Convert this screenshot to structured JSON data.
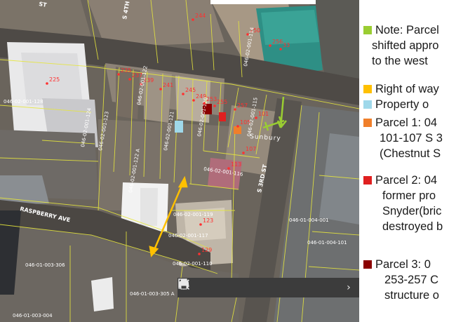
{
  "colors": {
    "note": "#9acd32",
    "row": "#ffc000",
    "property": "#9fd8ea",
    "parcel1": "#f07f2a",
    "parcel2": "#e02020",
    "parcel3": "#8b0000",
    "parcel_line": "#e6e63c",
    "address": "#ff3030"
  },
  "map": {
    "roads": {
      "raspberry": "RASPBERRY AVE",
      "third": "S 3RD ST",
      "fourth": "S 4TH",
      "top": "ST"
    },
    "town_label": "Sunbury",
    "addresses": [
      {
        "id": "a244",
        "text": "244"
      },
      {
        "id": "a250",
        "text": "250"
      },
      {
        "id": "a256",
        "text": "256"
      },
      {
        "id": "a33",
        "text": "33"
      },
      {
        "id": "a225",
        "text": "225"
      },
      {
        "id": "a235",
        "text": "235"
      },
      {
        "id": "a237",
        "text": "237"
      },
      {
        "id": "a239",
        "text": "239"
      },
      {
        "id": "a241",
        "text": "241"
      },
      {
        "id": "a245",
        "text": "245"
      },
      {
        "id": "a249",
        "text": "249"
      },
      {
        "id": "a253",
        "text": "253"
      },
      {
        "id": "a255",
        "text": "255"
      },
      {
        "id": "a257",
        "text": "257"
      },
      {
        "id": "a101",
        "text": "101"
      },
      {
        "id": "a105",
        "text": "105"
      },
      {
        "id": "a107",
        "text": "107"
      },
      {
        "id": "a113",
        "text": "113"
      },
      {
        "id": "a123",
        "text": "123"
      },
      {
        "id": "a129",
        "text": "129"
      }
    ],
    "parcel_ids": [
      {
        "id": "p1",
        "text": "046-02-001-128"
      },
      {
        "id": "p2",
        "text": "046-02-001-124"
      },
      {
        "id": "p3",
        "text": "046-02-001-123"
      },
      {
        "id": "p4",
        "text": "046-02-001-122"
      },
      {
        "id": "p5",
        "text": "046-02-001-121"
      },
      {
        "id": "p6",
        "text": "046-02-001-120"
      },
      {
        "id": "p7",
        "text": "046-02-001-115"
      },
      {
        "id": "p8",
        "text": "046-02-001-114"
      },
      {
        "id": "p9",
        "text": "046-02-001-116"
      },
      {
        "id": "p10",
        "text": "046-02-001-119"
      },
      {
        "id": "p11",
        "text": "046-02-001-117"
      },
      {
        "id": "p12",
        "text": "046-02-001-110"
      },
      {
        "id": "p13",
        "text": "046-01-003-306"
      },
      {
        "id": "p14",
        "text": "046-01-003-004"
      },
      {
        "id": "p15",
        "text": "046-01-003-305 A"
      },
      {
        "id": "p16",
        "text": "046-01-004-157"
      },
      {
        "id": "p17",
        "text": "046-01-004-001"
      },
      {
        "id": "p18",
        "text": "046-01-004-101"
      },
      {
        "id": "p19",
        "text": "046-02-001-122 A"
      }
    ]
  },
  "legend": {
    "note": [
      "Note: Parcel",
      "shifted appro",
      "to the west"
    ],
    "row": [
      "Right of way"
    ],
    "property": [
      "Property o"
    ],
    "parcel1": [
      "Parcel 1: 04",
      "101-107 S 3",
      "(Chestnut S"
    ],
    "parcel2": [
      "Parcel 2: 04",
      "former pro",
      "Snyder(bric",
      "destroyed b"
    ],
    "parcel3": [
      "Parcel 3: 0",
      "253-257 C",
      "structure o"
    ]
  },
  "toolbar": {
    "prev": "‹",
    "next": "›"
  }
}
